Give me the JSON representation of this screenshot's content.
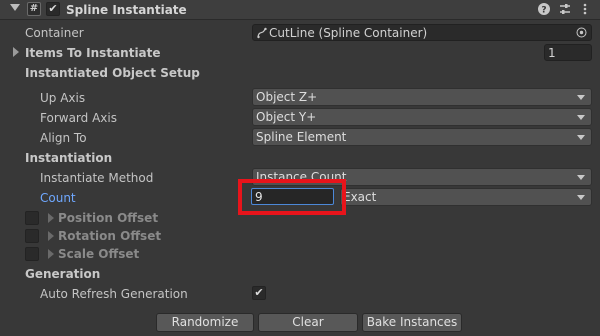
{
  "header": {
    "title": "Spline Instantiate",
    "script_icon": "#",
    "enabled_check": "✔",
    "help_icon": "help-icon",
    "settings_icon": "presets-icon",
    "menu_icon": "kebab-menu-icon"
  },
  "container": {
    "label": "Container",
    "value": "CutLine (Spline Container)",
    "icon": "spline-icon"
  },
  "items": {
    "label": "Items To Instantiate",
    "count": "1"
  },
  "setup": {
    "heading": "Instantiated Object Setup",
    "up_axis": {
      "label": "Up Axis",
      "value": "Object Z+"
    },
    "forward_axis": {
      "label": "Forward Axis",
      "value": "Object Y+"
    },
    "align_to": {
      "label": "Align To",
      "value": "Spline Element"
    }
  },
  "instantiation": {
    "heading": "Instantiation",
    "method": {
      "label": "Instantiate Method",
      "value": "Instance Count"
    },
    "count": {
      "label": "Count",
      "value": "9",
      "mode": "Exact"
    },
    "position_offset": "Position Offset",
    "rotation_offset": "Rotation Offset",
    "scale_offset": "Scale Offset"
  },
  "generation": {
    "heading": "Generation",
    "auto_refresh": {
      "label": "Auto Refresh Generation",
      "checked": "✔"
    }
  },
  "buttons": {
    "randomize": "Randomize",
    "clear": "Clear",
    "bake": "Bake Instances"
  },
  "colors": {
    "background": "#383838",
    "accent": "#4c88d8",
    "highlight": "#e8141b",
    "count_label": "#6fa8ff"
  }
}
